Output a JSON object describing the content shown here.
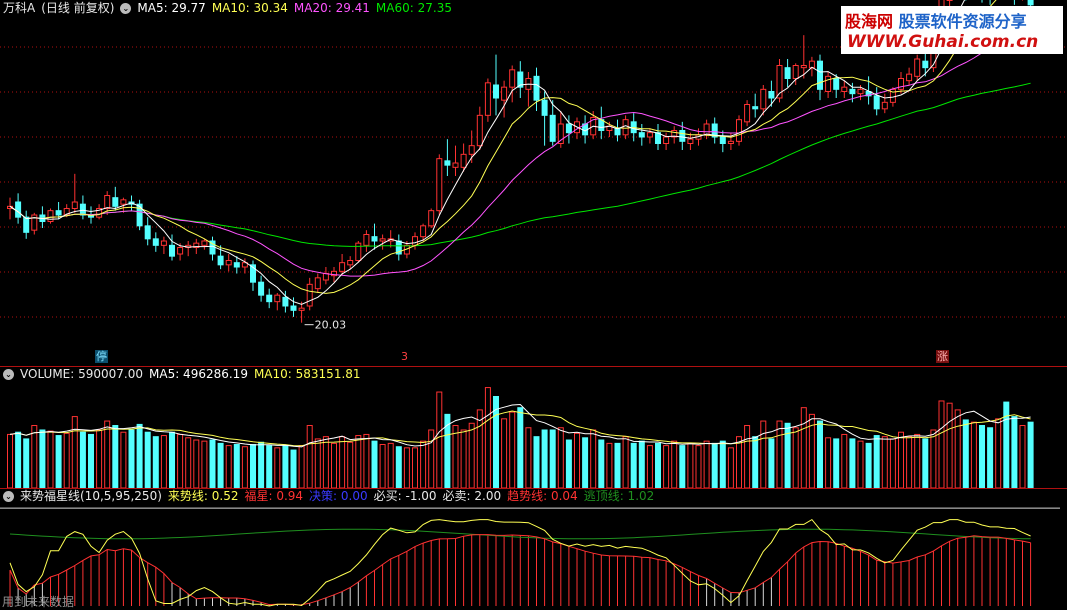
{
  "price_header": {
    "title": "万科A",
    "period": "(日线 前复权)",
    "ma5": "MA5: 29.77",
    "ma10": "MA10: 30.34",
    "ma20": "MA20: 29.41",
    "ma60": "MA60: 27.35"
  },
  "volume_header": {
    "label": "VOLUME: 590007.00",
    "ma5": "MA5: 496286.19",
    "ma10": "MA10: 583151.81"
  },
  "indicator_header": {
    "name": "来势福星线(10,5,95,250)",
    "laishi": "来势线: 0.52",
    "fuxing": "福星: 0.94",
    "juece": "决策: 0.00",
    "bimai": "必买: -1.00",
    "bimai2": "必卖: 2.00",
    "qushi": "趋势线: 0.04",
    "taoding": "逃顶线: 1.02"
  },
  "annotations": {
    "low_label": "20.03",
    "stop_marker": "停",
    "mid_marker": "3",
    "zhang_marker": "涨"
  },
  "footer": {
    "note": "用到未来数据"
  },
  "watermark": {
    "brand": "股海网",
    "tagline": "股票软件资源分享",
    "url": "WWW.Guhai.com.cn"
  },
  "colors": {
    "up": "#ff3232",
    "down": "#54ffff",
    "ma5": "#ffffff",
    "ma10": "#ffff54",
    "ma20": "#ff54ff",
    "ma60": "#00e600",
    "grid": "#b01010"
  },
  "chart_data": [
    {
      "type": "candlestick",
      "title": "万科A",
      "series_names": [
        "MA5",
        "MA10",
        "MA20",
        "MA60"
      ],
      "ylim": [
        19,
        34
      ],
      "ohlc": [
        [
          25.3,
          25.8,
          25.4,
          24.8
        ],
        [
          25.6,
          26.0,
          24.9,
          24.6
        ],
        [
          24.9,
          25.2,
          24.2,
          23.9
        ],
        [
          24.3,
          25.1,
          25.0,
          24.1
        ],
        [
          25.0,
          25.4,
          24.7,
          24.4
        ],
        [
          24.7,
          25.3,
          25.2,
          24.6
        ],
        [
          25.2,
          25.6,
          25.0,
          24.8
        ],
        [
          25.0,
          25.5,
          25.3,
          24.9
        ],
        [
          25.3,
          26.9,
          25.6,
          25.1
        ],
        [
          25.5,
          25.9,
          25.0,
          24.8
        ],
        [
          25.0,
          25.4,
          24.9,
          24.6
        ],
        [
          24.9,
          25.5,
          25.3,
          24.8
        ],
        [
          25.3,
          26.1,
          25.9,
          25.0
        ],
        [
          25.8,
          26.3,
          25.4,
          25.2
        ],
        [
          25.5,
          25.8,
          25.7,
          25.1
        ],
        [
          25.6,
          25.9,
          25.5,
          25.2
        ],
        [
          25.5,
          25.7,
          24.5,
          24.3
        ],
        [
          24.5,
          24.9,
          23.9,
          23.6
        ],
        [
          23.9,
          24.2,
          23.6,
          23.3
        ],
        [
          23.6,
          24.0,
          23.8,
          23.2
        ],
        [
          23.6,
          24.1,
          23.1,
          22.9
        ],
        [
          23.2,
          23.7,
          23.5,
          22.9
        ],
        [
          23.5,
          23.8,
          23.6,
          23.1
        ],
        [
          23.5,
          23.9,
          23.7,
          23.2
        ],
        [
          23.6,
          23.9,
          23.8,
          23.4
        ],
        [
          23.8,
          24.0,
          23.2,
          22.9
        ],
        [
          23.1,
          23.6,
          22.7,
          22.5
        ],
        [
          22.7,
          23.2,
          22.9,
          22.4
        ],
        [
          22.8,
          23.1,
          22.6,
          22.3
        ],
        [
          22.6,
          23.0,
          22.8,
          22.3
        ],
        [
          22.7,
          22.9,
          21.9,
          21.5
        ],
        [
          21.9,
          22.2,
          21.3,
          21.0
        ],
        [
          21.3,
          21.6,
          21.0,
          20.7
        ],
        [
          21.0,
          21.4,
          21.3,
          20.6
        ],
        [
          21.2,
          21.5,
          20.8,
          20.5
        ],
        [
          20.8,
          21.2,
          20.6,
          20.3
        ],
        [
          20.6,
          21.0,
          20.7,
          20.03
        ],
        [
          20.8,
          22.1,
          21.8,
          20.6
        ],
        [
          21.6,
          22.3,
          22.1,
          21.4
        ],
        [
          22.0,
          22.6,
          22.3,
          21.8
        ],
        [
          22.2,
          22.6,
          22.4,
          21.9
        ],
        [
          22.4,
          23.2,
          22.8,
          22.2
        ],
        [
          22.7,
          23.1,
          22.9,
          22.5
        ],
        [
          22.9,
          23.8,
          23.7,
          22.8
        ],
        [
          23.6,
          24.3,
          24.1,
          23.3
        ],
        [
          24.0,
          24.6,
          23.8,
          23.4
        ],
        [
          23.8,
          24.1,
          23.9,
          23.4
        ],
        [
          23.8,
          24.3,
          23.9,
          23.5
        ],
        [
          23.8,
          24.1,
          23.2,
          22.9
        ],
        [
          23.2,
          23.8,
          23.6,
          23.0
        ],
        [
          23.6,
          24.2,
          24.0,
          23.4
        ],
        [
          24.0,
          24.6,
          24.5,
          23.8
        ],
        [
          24.5,
          25.3,
          25.2,
          24.4
        ],
        [
          25.2,
          27.8,
          27.6,
          25.0
        ],
        [
          27.5,
          28.5,
          27.3,
          26.8
        ],
        [
          27.2,
          28.2,
          27.4,
          26.8
        ],
        [
          27.2,
          28.3,
          27.8,
          27.0
        ],
        [
          27.8,
          28.9,
          28.2,
          27.4
        ],
        [
          28.2,
          30.0,
          29.6,
          28.0
        ],
        [
          29.6,
          31.3,
          31.1,
          29.3
        ],
        [
          31.0,
          32.4,
          30.4,
          29.6
        ],
        [
          30.3,
          31.2,
          30.9,
          29.5
        ],
        [
          30.9,
          31.9,
          31.7,
          30.2
        ],
        [
          31.6,
          32.1,
          30.9,
          30.4
        ],
        [
          30.8,
          31.6,
          31.3,
          30.0
        ],
        [
          31.4,
          31.8,
          30.3,
          29.8
        ],
        [
          30.3,
          30.7,
          29.6,
          28.2
        ],
        [
          29.6,
          30.3,
          28.4,
          28.2
        ],
        [
          28.3,
          29.8,
          29.2,
          28.1
        ],
        [
          29.2,
          29.6,
          28.8,
          28.3
        ],
        [
          28.8,
          29.5,
          29.3,
          28.5
        ],
        [
          29.2,
          29.6,
          28.7,
          28.3
        ],
        [
          28.7,
          29.8,
          29.5,
          28.5
        ],
        [
          29.4,
          30.0,
          28.9,
          28.5
        ],
        [
          28.9,
          29.3,
          29.1,
          28.6
        ],
        [
          29.0,
          29.4,
          28.7,
          28.4
        ],
        [
          28.7,
          29.6,
          29.4,
          28.5
        ],
        [
          29.3,
          29.7,
          28.8,
          28.4
        ],
        [
          28.8,
          29.2,
          28.6,
          28.2
        ],
        [
          28.6,
          29.0,
          28.8,
          28.3
        ],
        [
          28.8,
          29.2,
          28.3,
          28.0
        ],
        [
          28.3,
          28.8,
          28.6,
          28.0
        ],
        [
          28.6,
          29.1,
          28.9,
          28.3
        ],
        [
          28.9,
          29.3,
          28.4,
          28.0
        ],
        [
          28.3,
          28.8,
          28.5,
          28.0
        ],
        [
          28.5,
          29.0,
          28.7,
          28.2
        ],
        [
          28.7,
          29.4,
          29.2,
          28.5
        ],
        [
          29.2,
          29.5,
          28.6,
          28.3
        ],
        [
          28.6,
          28.9,
          28.3,
          27.9
        ],
        [
          28.3,
          28.8,
          28.4,
          28.0
        ],
        [
          28.4,
          29.6,
          29.4,
          28.2
        ],
        [
          29.3,
          30.3,
          30.1,
          29.1
        ],
        [
          30.0,
          30.6,
          29.9,
          29.5
        ],
        [
          29.9,
          31.0,
          30.8,
          29.6
        ],
        [
          30.7,
          31.2,
          30.4,
          30.0
        ],
        [
          30.4,
          32.2,
          31.9,
          30.2
        ],
        [
          31.8,
          32.2,
          31.3,
          30.9
        ],
        [
          31.3,
          32.0,
          31.9,
          31.0
        ],
        [
          31.8,
          33.3,
          31.9,
          31.3
        ],
        [
          31.8,
          32.3,
          32.1,
          31.4
        ],
        [
          32.1,
          32.4,
          30.8,
          30.3
        ],
        [
          30.7,
          31.6,
          31.4,
          30.4
        ],
        [
          31.3,
          31.5,
          30.8,
          30.4
        ],
        [
          30.7,
          31.2,
          30.9,
          30.4
        ],
        [
          30.8,
          31.1,
          30.6,
          30.2
        ],
        [
          30.6,
          31.0,
          30.8,
          30.3
        ],
        [
          30.7,
          31.4,
          30.5,
          30.1
        ],
        [
          30.5,
          30.9,
          29.9,
          29.6
        ],
        [
          29.9,
          30.6,
          30.2,
          29.7
        ],
        [
          30.2,
          30.9,
          30.8,
          30.0
        ],
        [
          30.8,
          31.6,
          31.3,
          30.6
        ],
        [
          31.2,
          31.8,
          31.5,
          31.0
        ],
        [
          31.4,
          32.4,
          32.2,
          31.2
        ],
        [
          32.1,
          32.5,
          31.8,
          31.4
        ],
        [
          31.8,
          33.1,
          32.9,
          31.6
        ],
        [
          32.8,
          35.3,
          35.0,
          32.6
        ],
        [
          34.9,
          36.6,
          35.8,
          34.3
        ],
        [
          35.7,
          37.5,
          36.1,
          35.0
        ],
        [
          36.0,
          36.8,
          35.4,
          34.9
        ],
        [
          35.5,
          36.4,
          36.2,
          35.1
        ],
        [
          36.0,
          37.0,
          35.6,
          34.8
        ],
        [
          35.6,
          36.0,
          35.2,
          34.7
        ],
        [
          35.3,
          36.6,
          36.4,
          35.1
        ],
        [
          36.3,
          36.8,
          35.5,
          35.0
        ],
        [
          35.6,
          36.0,
          35.3,
          34.7
        ],
        [
          35.3,
          35.9,
          35.5,
          34.9
        ],
        [
          35.4,
          35.8,
          34.7,
          34.3
        ]
      ],
      "volume": [
        480000,
        500000,
        440000,
        560000,
        520000,
        510000,
        470000,
        490000,
        640000,
        500000,
        480000,
        520000,
        600000,
        560000,
        500000,
        520000,
        570000,
        500000,
        460000,
        470000,
        500000,
        480000,
        450000,
        430000,
        420000,
        430000,
        400000,
        380000,
        390000,
        370000,
        390000,
        410000,
        380000,
        360000,
        380000,
        340000,
        380000,
        560000,
        440000,
        460000,
        400000,
        460000,
        410000,
        470000,
        480000,
        420000,
        390000,
        400000,
        370000,
        360000,
        360000,
        420000,
        520000,
        860000,
        660000,
        560000,
        520000,
        580000,
        700000,
        900000,
        820000,
        620000,
        680000,
        720000,
        540000,
        460000,
        520000,
        520000,
        540000,
        430000,
        490000,
        450000,
        520000,
        430000,
        400000,
        400000,
        460000,
        400000,
        420000,
        380000,
        400000,
        380000,
        420000,
        380000,
        400000,
        380000,
        420000,
        400000,
        420000,
        360000,
        460000,
        560000,
        460000,
        600000,
        440000,
        600000,
        580000,
        540000,
        720000,
        660000,
        600000,
        450000,
        440000,
        480000,
        440000,
        420000,
        400000,
        470000,
        460000,
        440000,
        500000,
        460000,
        480000,
        440000,
        520000,
        780000,
        760000,
        700000,
        610000,
        590000,
        560000,
        540000,
        620000,
        770000,
        640000,
        560000,
        590000
      ]
    }
  ]
}
